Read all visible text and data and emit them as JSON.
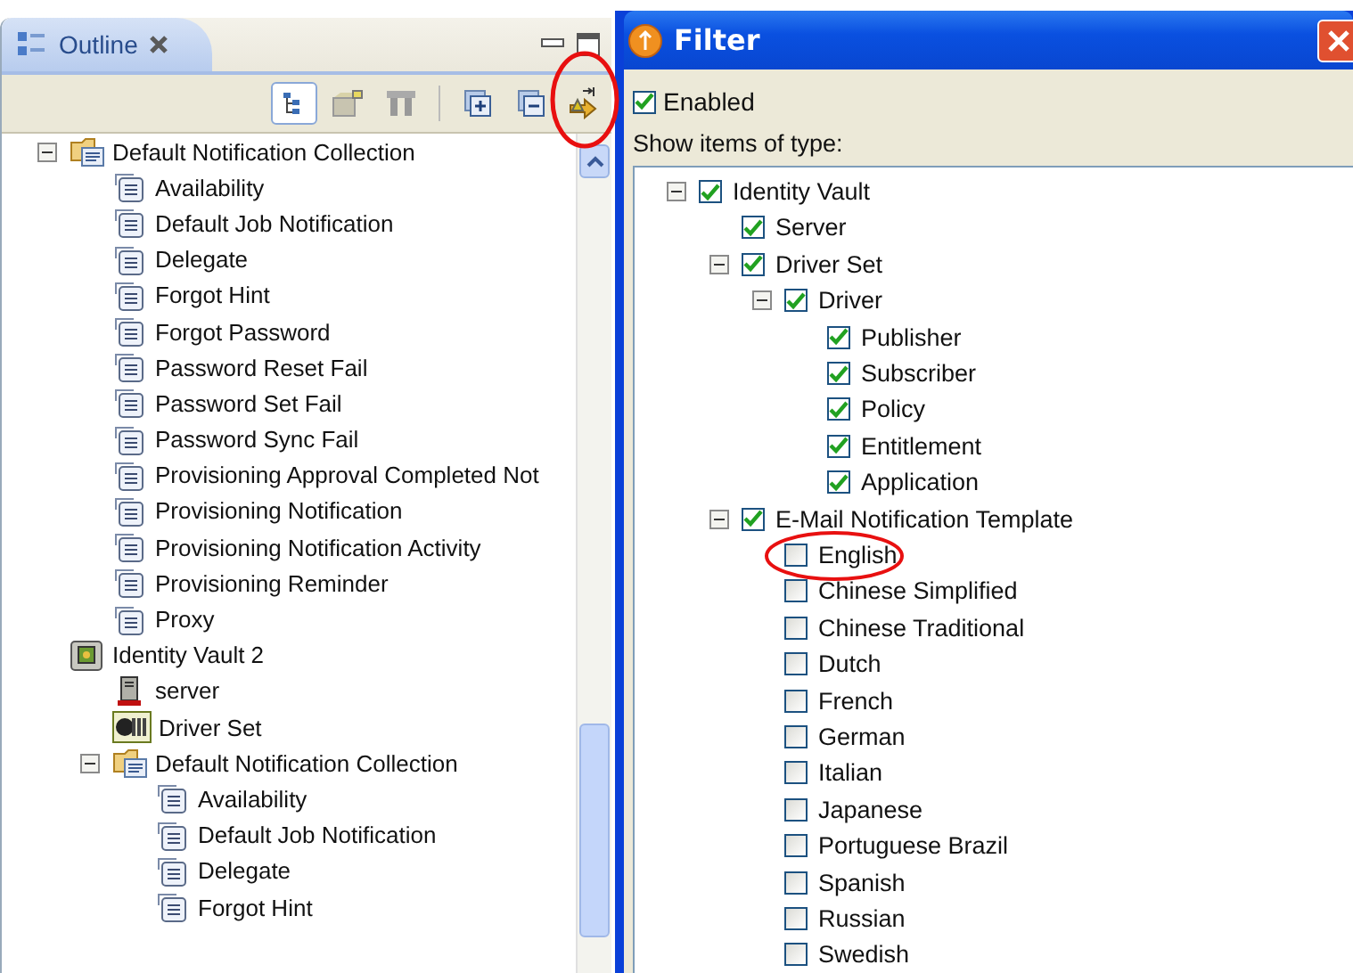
{
  "outline": {
    "tab": {
      "label": "Outline",
      "selected": true
    },
    "toolbar": [
      {
        "kind": "tree",
        "selected": true
      },
      {
        "kind": "table",
        "selected": false
      },
      {
        "kind": "filter",
        "selected": false
      },
      {
        "kind": "expand-all",
        "selected": false
      },
      {
        "kind": "collapse-all",
        "selected": false
      },
      {
        "kind": "link",
        "selected": false,
        "circled": true
      }
    ],
    "tree": [
      {
        "label": "Default Notification Collection",
        "kind": "collection",
        "expanded": true,
        "children": [
          {
            "label": "Availability",
            "kind": "template"
          },
          {
            "label": "Default Job Notification",
            "kind": "template"
          },
          {
            "label": "Delegate",
            "kind": "template"
          },
          {
            "label": "Forgot Hint",
            "kind": "template"
          },
          {
            "label": "Forgot Password",
            "kind": "template"
          },
          {
            "label": "Password Reset Fail",
            "kind": "template"
          },
          {
            "label": "Password Set Fail",
            "kind": "template"
          },
          {
            "label": "Password Sync Fail",
            "kind": "template"
          },
          {
            "label": "Provisioning Approval Completed Not",
            "kind": "template"
          },
          {
            "label": "Provisioning Notification",
            "kind": "template"
          },
          {
            "label": "Provisioning Notification Activity",
            "kind": "template"
          },
          {
            "label": "Provisioning Reminder",
            "kind": "template"
          },
          {
            "label": "Proxy",
            "kind": "template"
          }
        ]
      },
      {
        "label": "Identity Vault 2",
        "kind": "vault",
        "children": [
          {
            "label": "server",
            "kind": "server"
          },
          {
            "label": "Driver Set",
            "kind": "driver-set"
          },
          {
            "label": "Default Notification Collection",
            "kind": "collection",
            "expanded": true,
            "children": [
              {
                "label": "Availability",
                "kind": "template"
              },
              {
                "label": "Default Job Notification",
                "kind": "template"
              },
              {
                "label": "Delegate",
                "kind": "template"
              },
              {
                "label": "Forgot Hint",
                "kind": "template"
              }
            ]
          }
        ]
      }
    ]
  },
  "filter": {
    "title": "Filter",
    "enabled": {
      "label": "Enabled",
      "checked": true
    },
    "show_label": "Show items of type:",
    "tree": [
      {
        "label": "Identity Vault",
        "checked": true,
        "expanded": true,
        "children": [
          {
            "label": "Server",
            "checked": true
          },
          {
            "label": "Driver Set",
            "checked": true,
            "expanded": true,
            "children": [
              {
                "label": "Driver",
                "checked": true,
                "expanded": true,
                "children": [
                  {
                    "label": "Publisher",
                    "checked": true
                  },
                  {
                    "label": "Subscriber",
                    "checked": true
                  },
                  {
                    "label": "Policy",
                    "checked": true
                  },
                  {
                    "label": "Entitlement",
                    "checked": true
                  },
                  {
                    "label": "Application",
                    "checked": true
                  }
                ]
              }
            ]
          },
          {
            "label": "E-Mail Notification Template",
            "checked": true,
            "expanded": true,
            "children": [
              {
                "label": "English",
                "checked": false,
                "circled": true
              },
              {
                "label": "Chinese Simplified",
                "checked": false
              },
              {
                "label": "Chinese Traditional",
                "checked": false
              },
              {
                "label": "Dutch",
                "checked": false
              },
              {
                "label": "French",
                "checked": false
              },
              {
                "label": "German",
                "checked": false
              },
              {
                "label": "Italian",
                "checked": false
              },
              {
                "label": "Japanese",
                "checked": false
              },
              {
                "label": "Portuguese Brazil",
                "checked": false
              },
              {
                "label": "Spanish",
                "checked": false
              },
              {
                "label": "Russian",
                "checked": false
              },
              {
                "label": "Swedish",
                "checked": false
              }
            ]
          }
        ]
      }
    ]
  }
}
